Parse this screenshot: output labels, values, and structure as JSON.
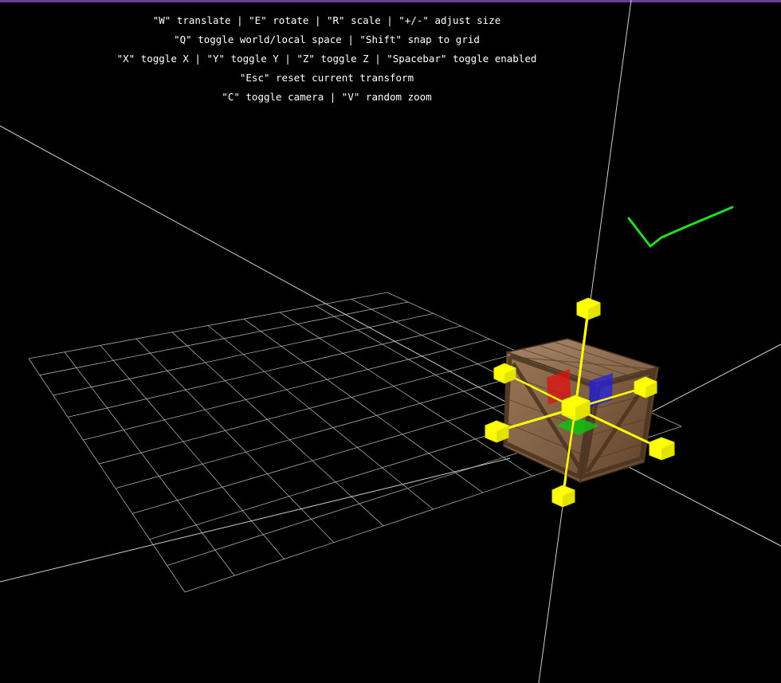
{
  "instructions": [
    "\"W\" translate | \"E\" rotate | \"R\" scale | \"+/-\" adjust size",
    "\"Q\" toggle world/local space | \"Shift\" snap to grid",
    "\"X\" toggle X | \"Y\" toggle Y | \"Z\" toggle Z | \"Spacebar\" toggle enabled",
    "\"Esc\" reset current transform",
    "\"C\" toggle camera | \"V\" random zoom"
  ],
  "colors": {
    "background": "#000000",
    "top_border": "#6b3fa0",
    "text": "#ffffff",
    "grid_lines": "#d0d0d0",
    "gizmo_handles": "#ffff00",
    "plane_handle_red": "#e01010",
    "plane_handle_blue": "#2020e0",
    "plane_handle_green": "#10c010",
    "check_mark": "#22dd22",
    "crate_wood": "#8a6a4a"
  },
  "scene": {
    "object": "wooden-crate",
    "gizmo_mode": "scale",
    "icons": [
      "scale-gizmo-icon",
      "check-mark-icon"
    ]
  }
}
